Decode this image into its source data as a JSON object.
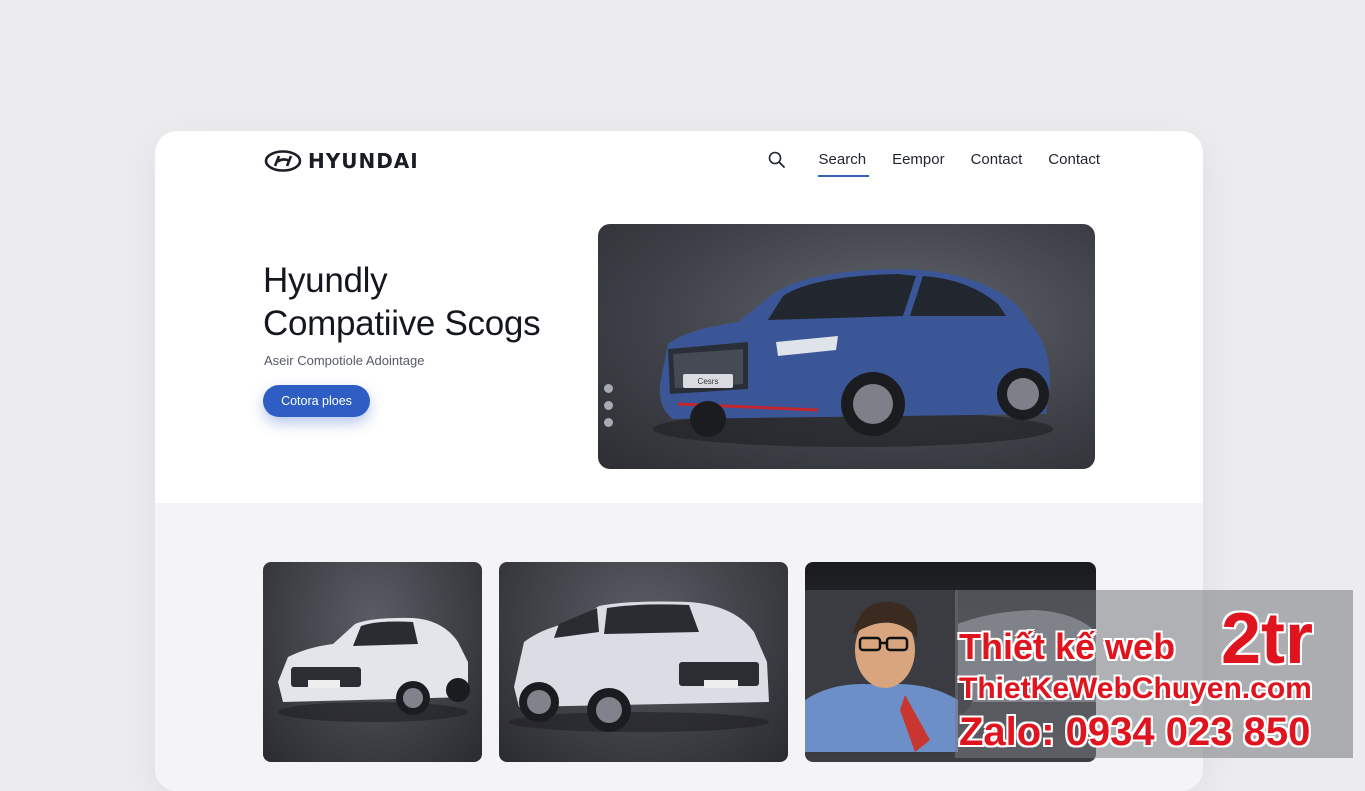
{
  "brand": {
    "name": "HYUNDAI",
    "logo_icon": "hyundai-logo-icon"
  },
  "nav": {
    "items": [
      {
        "label": "Search",
        "active": true
      },
      {
        "label": "Eempor",
        "active": false
      },
      {
        "label": "Contact",
        "active": false
      },
      {
        "label": "Contact",
        "active": false
      }
    ]
  },
  "hero": {
    "title_line1": "Hyundly",
    "title_line2": "Compatiive Scogs",
    "subtitle": "Aseir Compotiole Adointage",
    "cta_label": "Cotora ploes",
    "car_badge": "Cesrs",
    "slider_dots": 3
  },
  "gallery": {
    "items": [
      {
        "badge": ""
      },
      {
        "badge": ""
      },
      {
        "badge": ""
      }
    ]
  },
  "watermark": {
    "line1": "Thiết kế web",
    "line1_big": "2tr",
    "line2": "ThietKeWebChuyen.com",
    "line3": "Zalo: 0934 023 850"
  },
  "colors": {
    "accent": "#2e5ec4",
    "nav_underline": "#3562b4",
    "hero_car": "#3b5696",
    "promo_red": "#e0141e"
  }
}
